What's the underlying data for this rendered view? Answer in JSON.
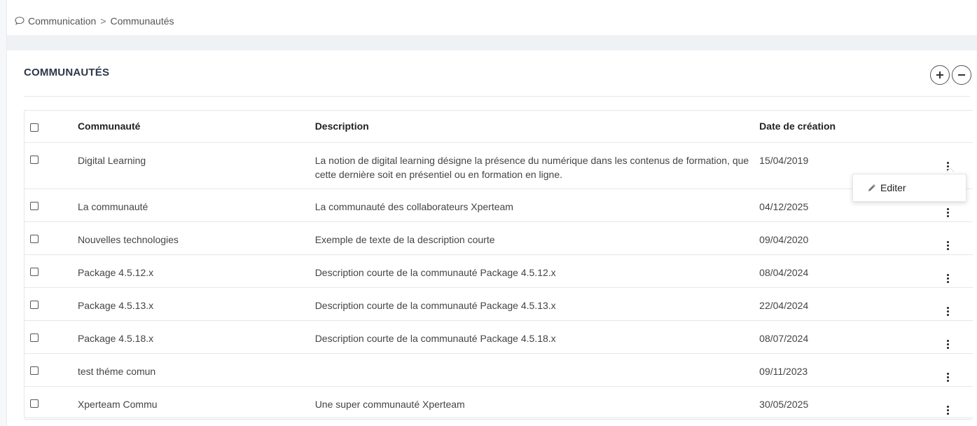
{
  "breadcrumb": {
    "icon": "chat-bubble-icon",
    "parent": "Communication",
    "separator": ">",
    "current": "Communautés"
  },
  "section": {
    "title": "COMMUNAUTÉS"
  },
  "actions": {
    "add_icon": "plus-icon",
    "remove_icon": "minus-icon"
  },
  "table": {
    "headers": {
      "name": "Communauté",
      "description": "Description",
      "date": "Date de création"
    },
    "rows": [
      {
        "name": "Digital Learning",
        "description": "La notion de digital learning désigne la présence du numérique dans les contenus de formation, que cette dernière soit en présentiel ou en formation en ligne.",
        "date": "15/04/2019"
      },
      {
        "name": "La communauté",
        "description": "La communauté des collaborateurs Xperteam",
        "date": "04/12/2025"
      },
      {
        "name": "Nouvelles technologies",
        "description": "Exemple de texte de la description courte",
        "date": "09/04/2020"
      },
      {
        "name": "Package 4.5.12.x",
        "description": "Description courte de la communauté Package 4.5.12.x",
        "date": "08/04/2024"
      },
      {
        "name": "Package 4.5.13.x",
        "description": "Description courte de la communauté Package 4.5.13.x",
        "date": "22/04/2024"
      },
      {
        "name": "Package 4.5.18.x",
        "description": "Description courte de la communauté Package 4.5.18.x",
        "date": "08/07/2024"
      },
      {
        "name": "test théme comun",
        "description": "",
        "date": "09/11/2023"
      },
      {
        "name": "Xperteam Commu",
        "description": "Une super communauté Xperteam",
        "date": "30/05/2025"
      }
    ]
  },
  "row_menu": {
    "edit_label": "Editer",
    "edit_icon": "pencil-icon"
  }
}
